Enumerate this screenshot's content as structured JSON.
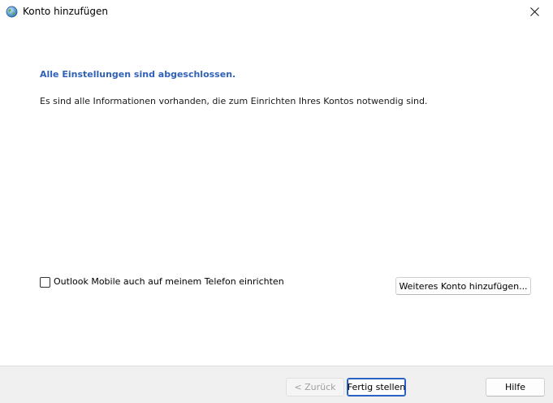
{
  "window": {
    "title": "Konto hinzufügen"
  },
  "content": {
    "heading": "Alle Einstellungen sind abgeschlossen.",
    "info": "Es sind alle Informationen vorhanden, die zum Einrichten Ihres Kontos notwendig sind.",
    "mobile_checkbox": {
      "label": "Outlook Mobile auch auf meinem Telefon einrichten",
      "checked": false
    },
    "add_account_label": "Weiteres Konto hinzufügen..."
  },
  "footer": {
    "back_label": "< Zurück",
    "finish_label": "Fertig stellen",
    "help_label": "Hilfe"
  },
  "colors": {
    "heading": "#3061b8",
    "focus_border": "#2a62c4",
    "footer_bg": "#f0f0f0"
  },
  "icons": {
    "app": "globe-icon",
    "close": "close-icon"
  }
}
